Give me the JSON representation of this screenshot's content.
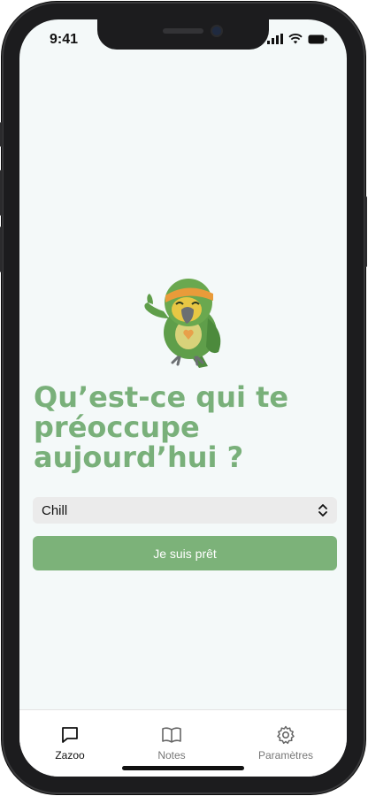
{
  "status_bar": {
    "time": "9:41"
  },
  "main": {
    "headline": "Qu’est-ce qui te préoccupe aujourd’hui ?",
    "mood_select": {
      "selected": "Chill"
    },
    "ready_button_label": "Je suis prêt"
  },
  "tab_bar": {
    "tabs": [
      {
        "label": "Zazoo",
        "icon": "chat-bubble-icon",
        "active": true
      },
      {
        "label": "Notes",
        "icon": "book-icon",
        "active": false
      },
      {
        "label": "Paramètres",
        "icon": "gear-icon",
        "active": false
      }
    ]
  },
  "colors": {
    "accent": "#79b07a",
    "button": "#7cb279",
    "screen_bg": "#f4f9f9"
  }
}
